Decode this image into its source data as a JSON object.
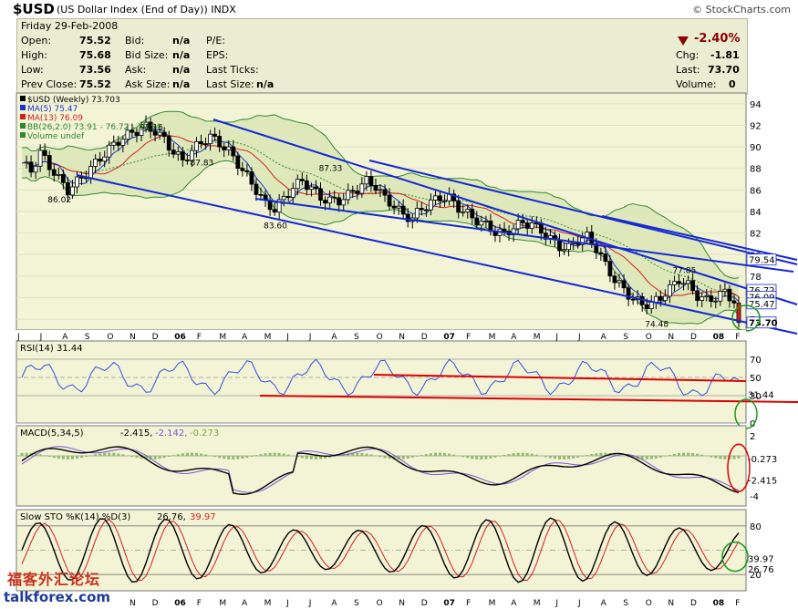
{
  "header": {
    "symbol": "$USD",
    "name": "(US Dollar Index (End of Day))",
    "exchange": "INDX",
    "copyright": "© StockCharts.com"
  },
  "quote": {
    "date": "Friday   29-Feb-2008",
    "open_label": "Open:",
    "open": "75.52",
    "high_label": "High:",
    "high": "75.68",
    "low_label": "Low:",
    "low": "73.56",
    "prev_label": "Prev Close:",
    "prev": "75.52",
    "bid_label": "Bid:",
    "bid": "n/a",
    "bidsize_label": "Bid Size:",
    "bidsize": "n/a",
    "ask_label": "Ask:",
    "ask": "n/a",
    "asksize_label": "Ask Size:",
    "asksize": "n/a",
    "pe_label": "P/E:",
    "eps_label": "EPS:",
    "lastticks_label": "Last Ticks:",
    "lastsize_label": "Last Size:",
    "lastsize": "n/a",
    "pct": "-2.40%",
    "chg_label": "Chg:",
    "chg": "-1.81",
    "last_label": "Last:",
    "last": "73.70",
    "vol_label": "Volume:",
    "vol": "0",
    "down_color": "#8b0000"
  },
  "chart_data": [
    {
      "type": "candlestick",
      "legend": [
        "$USD (Weekly) 73.703",
        "MA(5) 75.47",
        "MA(13) 76.09",
        "BB(26,2.0) 73.91 - 76.72 - 79.54",
        "Volume undef"
      ],
      "x_ticks": [
        "J",
        "J",
        "A",
        "S",
        "O",
        "N",
        "D",
        "06",
        "F",
        "M",
        "A",
        "M",
        "J",
        "J",
        "A",
        "S",
        "O",
        "N",
        "D",
        "07",
        "F",
        "M",
        "A",
        "M",
        "J",
        "J",
        "A",
        "S",
        "O",
        "N",
        "D",
        "08",
        "F"
      ],
      "y_ticks": [
        "94",
        "92",
        "90",
        "88",
        "86",
        "84",
        "82",
        "80",
        "78",
        "76",
        "74"
      ],
      "ylim": [
        73,
        95
      ],
      "close_points": [
        [
          0,
          88.5
        ],
        [
          2,
          87.6
        ],
        [
          4,
          89.2
        ],
        [
          6,
          88.0
        ],
        [
          8,
          87.0
        ],
        [
          10,
          86.1
        ],
        [
          12,
          87.0
        ],
        [
          15,
          88.2
        ],
        [
          18,
          89.3
        ],
        [
          21,
          90.3
        ],
        [
          24,
          91.2
        ],
        [
          27,
          92.0
        ],
        [
          29,
          91.7
        ],
        [
          31,
          90.9
        ],
        [
          33,
          89.6
        ],
        [
          35,
          88.6
        ],
        [
          37,
          89.4
        ],
        [
          39,
          90.2
        ],
        [
          41,
          90.8
        ],
        [
          43,
          90.4
        ],
        [
          45,
          89.8
        ],
        [
          47,
          88.7
        ],
        [
          49,
          87.4
        ],
        [
          51,
          86.0
        ],
        [
          53,
          84.5
        ],
        [
          55,
          84.0
        ],
        [
          57,
          85.0
        ],
        [
          59,
          86.2
        ],
        [
          61,
          87.0
        ],
        [
          63,
          86.4
        ],
        [
          65,
          85.5
        ],
        [
          67,
          85.1
        ],
        [
          69,
          84.9
        ],
        [
          71,
          85.3
        ],
        [
          73,
          85.9
        ],
        [
          75,
          86.7
        ],
        [
          77,
          86.4
        ],
        [
          79,
          85.4
        ],
        [
          81,
          84.8
        ],
        [
          83,
          83.8
        ],
        [
          85,
          83.4
        ],
        [
          87,
          84.1
        ],
        [
          89,
          84.6
        ],
        [
          91,
          85.1
        ],
        [
          93,
          85.2
        ],
        [
          95,
          84.5
        ],
        [
          97,
          84.0
        ],
        [
          99,
          83.4
        ],
        [
          101,
          82.8
        ],
        [
          103,
          82.0
        ],
        [
          105,
          81.7
        ],
        [
          107,
          82.3
        ],
        [
          109,
          82.8
        ],
        [
          111,
          82.9
        ],
        [
          113,
          82.4
        ],
        [
          115,
          81.7
        ],
        [
          117,
          80.9
        ],
        [
          119,
          80.6
        ],
        [
          121,
          81.2
        ],
        [
          123,
          81.4
        ],
        [
          125,
          80.4
        ],
        [
          127,
          79.0
        ],
        [
          129,
          77.8
        ],
        [
          131,
          77.0
        ],
        [
          133,
          76.1
        ],
        [
          135,
          75.5
        ],
        [
          137,
          75.3
        ],
        [
          139,
          75.8
        ],
        [
          141,
          76.6
        ],
        [
          143,
          77.6
        ],
        [
          145,
          77.2
        ],
        [
          147,
          76.4
        ],
        [
          149,
          76.0
        ],
        [
          151,
          76.2
        ],
        [
          153,
          76.5
        ],
        [
          155,
          75.5
        ],
        [
          156,
          73.7
        ]
      ],
      "annotations": [
        {
          "label": "86.02",
          "x": 8,
          "y": 86.02
        },
        {
          "label": "91.16",
          "x": 28,
          "y": 91.16
        },
        {
          "label": "87.83",
          "x": 39,
          "y": 87.83
        },
        {
          "label": "83.60",
          "x": 55,
          "y": 83.6
        },
        {
          "label": "87.33",
          "x": 67,
          "y": 87.33
        },
        {
          "label": "77.85",
          "x": 144,
          "y": 77.85
        },
        {
          "label": "74.48",
          "x": 138,
          "y": 74.48
        }
      ],
      "price_tags": [
        "79.54",
        "76.72",
        "76.09",
        "75.47",
        "73.70"
      ]
    },
    {
      "type": "line",
      "legend": [
        "RSI(14) 31.44"
      ],
      "y_ticks": [
        "70",
        "50",
        "30",
        "0"
      ],
      "ylim": [
        0,
        90
      ],
      "last_value": "31.44"
    },
    {
      "type": "line",
      "legend": [
        "MACD(5,34,5)",
        "-2.415,",
        "-2.142,",
        "-0.273"
      ],
      "y_ticks": [
        "2",
        "-4"
      ],
      "ylim": [
        -5,
        3
      ],
      "last_values": [
        "-0.273",
        "-2.415"
      ]
    },
    {
      "type": "line",
      "legend": [
        "Slow STO %K(14) %D(3)",
        "26.76,",
        "39.97"
      ],
      "y_ticks": [
        "80",
        "20"
      ],
      "ylim": [
        0,
        100
      ],
      "last_values": [
        "39.97",
        "26.76"
      ]
    }
  ],
  "watermark": {
    "line1": "福客外汇论坛",
    "line2": "talkforex.com"
  }
}
